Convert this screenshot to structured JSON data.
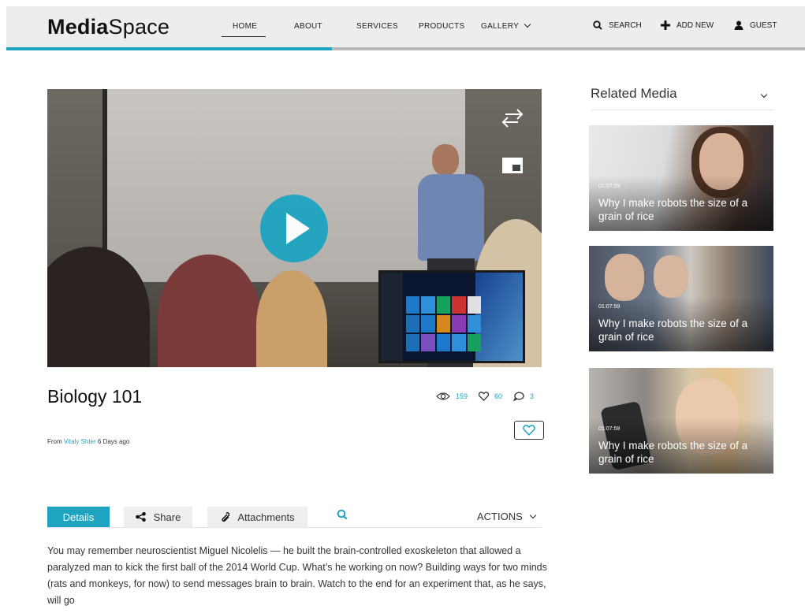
{
  "brand": {
    "bold": "Media",
    "light": "Space"
  },
  "nav": {
    "home": "HOME",
    "about": "ABOUT",
    "services": "SERVICES",
    "products": "PRODUCTS",
    "gallery": "GALLERY"
  },
  "utility": {
    "search": "SEARCH",
    "add_new": "ADD NEW",
    "guest": "GUEST"
  },
  "video": {
    "title": "Biology 101",
    "from_prefix": "From",
    "author": "Vitaly Shter",
    "age": "6 Days ago",
    "views": "159",
    "likes": "60",
    "comments": "3"
  },
  "tabs": {
    "details": "Details",
    "share": "Share",
    "attachments": "Attachments",
    "actions": "ACTIONS"
  },
  "description": "You may remember neuroscientist Miguel Nicolelis — he built the brain-controlled exoskeleton that allowed a paralyzed man to kick the first ball of the 2014 World Cup. What’s he working on now? Building ways for two minds (rats and monkeys, for now) to send messages brain to brain. Watch to the end for an experiment that, as he says, will go",
  "related": {
    "heading": "Related Media",
    "items": [
      {
        "duration": "01:07:59",
        "title": "Why I make robots the size of a grain of rice"
      },
      {
        "duration": "01:07:59",
        "title": "Why I make robots the size of a grain of rice"
      },
      {
        "duration": "01:07:59",
        "title": "Why I make robots the size of a grain of rice"
      }
    ]
  },
  "colors": {
    "accent": "#1ea4c1",
    "header_bg": "#ededed"
  }
}
